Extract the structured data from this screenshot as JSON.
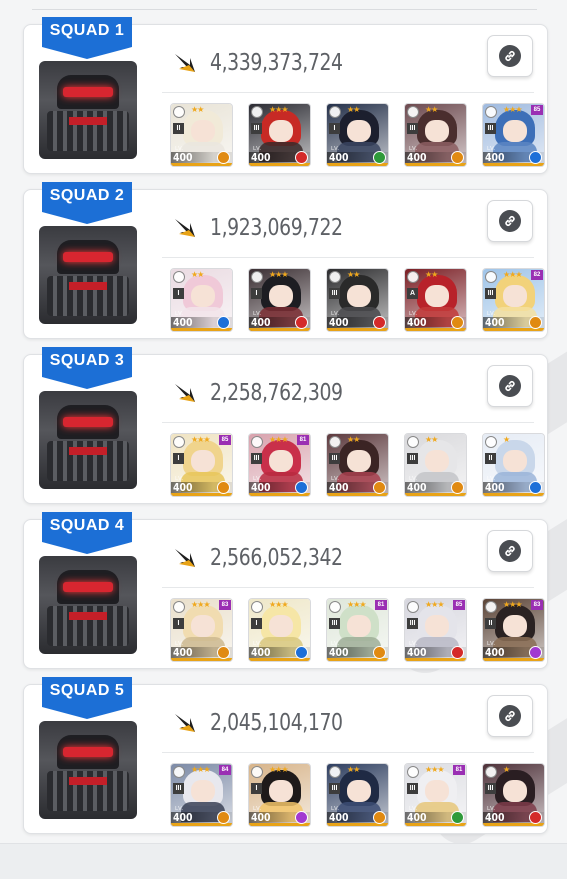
{
  "colors": {
    "accent": "#1c6fd6",
    "fire": "#d42a2a",
    "water": "#1d6fd8",
    "wind": "#2f9a3a",
    "iron": "#e08a12",
    "electric": "#a23ad1",
    "overload": "#9a2fb3"
  },
  "squads": [
    {
      "label": "SQUAD 1",
      "damage": "4,339,373,724",
      "link_icon": "link-icon",
      "characters": [
        {
          "level": "400",
          "burst": "II",
          "element": "iron",
          "stars": "★★",
          "overload": "",
          "hair": "#f1ead8",
          "bg": "#e8e3d6",
          "body": "#eae6df"
        },
        {
          "level": "400",
          "burst": "III",
          "element": "fire",
          "stars": "★★★",
          "overload": "",
          "hair": "#c72a25",
          "bg": "#2b2b32",
          "body": "#3a2a2a"
        },
        {
          "level": "400",
          "burst": "I",
          "element": "wind",
          "stars": "★★",
          "overload": "",
          "hair": "#1c1f2e",
          "bg": "#25314a",
          "body": "#3a4560"
        },
        {
          "level": "400",
          "burst": "III",
          "element": "iron",
          "stars": "★★",
          "overload": "",
          "hair": "#4a2e2e",
          "bg": "#6d4a4f",
          "body": "#8c5e62"
        },
        {
          "level": "400",
          "burst": "III",
          "element": "water",
          "stars": "★★★",
          "overload": "85",
          "hair": "#3d6fb8",
          "bg": "#9fbadf",
          "body": "#5c86c2"
        }
      ]
    },
    {
      "label": "SQUAD 2",
      "damage": "1,923,069,722",
      "link_icon": "link-icon",
      "characters": [
        {
          "level": "400",
          "burst": "I",
          "element": "water",
          "stars": "★★",
          "overload": "",
          "hair": "#f0c9d8",
          "bg": "#eadbe2",
          "body": "#f2e4ea"
        },
        {
          "level": "400",
          "burst": "I",
          "element": "fire",
          "stars": "★★★",
          "overload": "",
          "hair": "#1d1d22",
          "bg": "#3b2f33",
          "body": "#7a2d33"
        },
        {
          "level": "400",
          "burst": "III",
          "element": "fire",
          "stars": "★★",
          "overload": "",
          "hair": "#2a2a2a",
          "bg": "#2c2c2e",
          "body": "#4a4a4e"
        },
        {
          "level": "400",
          "burst": "A",
          "element": "iron",
          "stars": "★★",
          "overload": "",
          "hair": "#b8222a",
          "bg": "#7a1f25",
          "body": "#c23a3a"
        },
        {
          "level": "400",
          "burst": "III",
          "element": "iron",
          "stars": "★★★",
          "overload": "82",
          "hair": "#f2d27a",
          "bg": "#9fc4e8",
          "body": "#f4e0a0"
        }
      ]
    },
    {
      "label": "SQUAD 3",
      "damage": "2,258,762,309",
      "link_icon": "link-icon",
      "characters": [
        {
          "level": "400",
          "burst": "I",
          "element": "iron",
          "stars": "★★★",
          "overload": "85",
          "hair": "#f0d48c",
          "bg": "#efe3c2",
          "body": "#e7c659"
        },
        {
          "level": "400",
          "burst": "III",
          "element": "water",
          "stars": "★★★",
          "overload": "81",
          "hair": "#c9304a",
          "bg": "#d8a2ad",
          "body": "#b92a3f"
        },
        {
          "level": "400",
          "burst": "III",
          "element": "iron",
          "stars": "★★",
          "overload": "",
          "hair": "#3b2424",
          "bg": "#5d3a3e",
          "body": "#a8414f"
        },
        {
          "level": "400",
          "burst": "III",
          "element": "iron",
          "stars": "★★",
          "overload": "",
          "hair": "#e6e6e8",
          "bg": "#d9d9dc",
          "body": "#c3c4c8"
        },
        {
          "level": "400",
          "burst": "II",
          "element": "water",
          "stars": "★",
          "overload": "",
          "hair": "#c9d7ea",
          "bg": "#e6ecf5",
          "body": "#9ab4d8"
        }
      ]
    },
    {
      "label": "SQUAD 4",
      "damage": "2,566,052,342",
      "link_icon": "link-icon",
      "characters": [
        {
          "level": "400",
          "burst": "I",
          "element": "iron",
          "stars": "★★★",
          "overload": "83",
          "hair": "#f1dcb0",
          "bg": "#e9dfcb",
          "body": "#cdb88f"
        },
        {
          "level": "400",
          "burst": "I",
          "element": "water",
          "stars": "★★★",
          "overload": "",
          "hair": "#f6e6a6",
          "bg": "#eee7c8",
          "body": "#d8c77e"
        },
        {
          "level": "400",
          "burst": "III",
          "element": "iron",
          "stars": "★★★",
          "overload": "81",
          "hair": "#cfe0c8",
          "bg": "#dfe7da",
          "body": "#9fae98"
        },
        {
          "level": "400",
          "burst": "III",
          "element": "fire",
          "stars": "★★★",
          "overload": "85",
          "hair": "#e4e4ea",
          "bg": "#d6d6de",
          "body": "#b8b8c6"
        },
        {
          "level": "400",
          "burst": "II",
          "element": "electric",
          "stars": "★★★",
          "overload": "83",
          "hair": "#2a2222",
          "bg": "#5a4336",
          "body": "#8a6d55"
        }
      ]
    },
    {
      "label": "SQUAD 5",
      "damage": "2,045,104,170",
      "link_icon": "link-icon",
      "characters": [
        {
          "level": "400",
          "burst": "III",
          "element": "iron",
          "stars": "★★★",
          "overload": "84",
          "hair": "#e8e8ee",
          "bg": "#7c8aa6",
          "body": "#3a4156"
        },
        {
          "level": "400",
          "burst": "I",
          "element": "electric",
          "stars": "★★★",
          "overload": "",
          "hair": "#1e1a1a",
          "bg": "#d7b48a",
          "body": "#f2c46a"
        },
        {
          "level": "400",
          "burst": "III",
          "element": "iron",
          "stars": "★★",
          "overload": "",
          "hair": "#1f2a44",
          "bg": "#2f3f60",
          "body": "#3d4e74"
        },
        {
          "level": "400",
          "burst": "III",
          "element": "wind",
          "stars": "★★★",
          "overload": "81",
          "hair": "#efeff2",
          "bg": "#dcdde2",
          "body": "#e6c77a"
        },
        {
          "level": "400",
          "burst": "III",
          "element": "fire",
          "stars": "★",
          "overload": "",
          "hair": "#2a1e22",
          "bg": "#4d3038",
          "body": "#7e3c4a"
        }
      ]
    }
  ]
}
